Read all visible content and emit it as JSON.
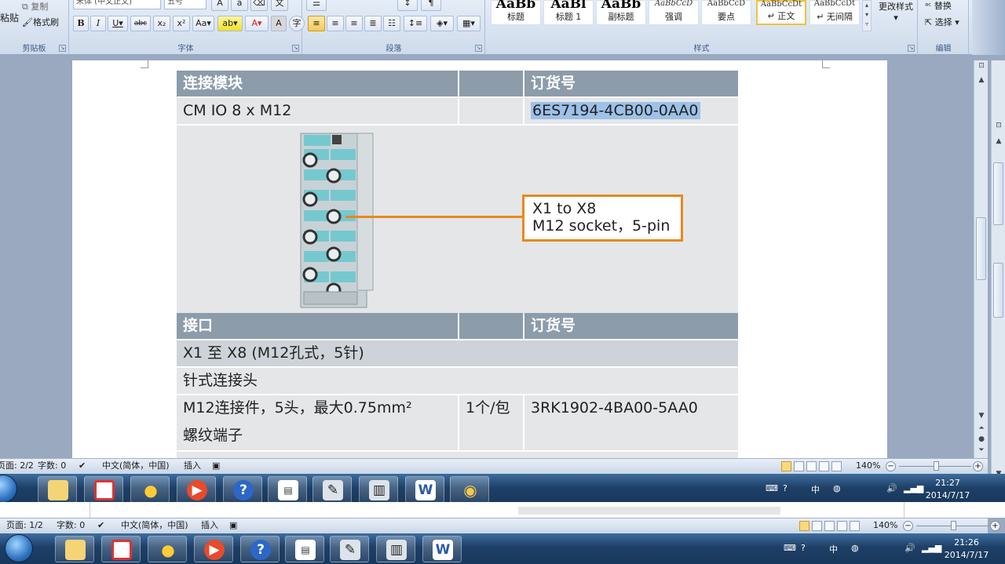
{
  "ribbon": {
    "clipboard": {
      "paste_label": "粘贴",
      "copy_label": "复制",
      "format_painter_label": "格式刷",
      "group_label": "剪贴板"
    },
    "font": {
      "font_name": "宋体 (中文正文)",
      "font_size": "五号",
      "group_label": "字体",
      "buttons": [
        "B",
        "I",
        "U",
        "abc",
        "x₂",
        "x²",
        "Aa",
        "ab",
        "A",
        "A",
        "字"
      ]
    },
    "paragraph": {
      "group_label": "段落"
    },
    "styles": {
      "group_label": "样式",
      "change_styles_label": "更改样式",
      "tiles": [
        {
          "preview": "AaBb",
          "name": "标题"
        },
        {
          "preview": "AaBl",
          "name": "标题 1"
        },
        {
          "preview": "AaBb",
          "name": "副标题"
        },
        {
          "preview": "AaBbCcD",
          "name": "强调"
        },
        {
          "preview": "AaBbCcD",
          "name": "要点"
        },
        {
          "preview": "AaBbCcDt",
          "name": "↵ 正文"
        },
        {
          "preview": "AaBbCcDt",
          "name": "↵ 无间隔"
        }
      ]
    },
    "editing": {
      "group_label": "编辑",
      "replace_label": "替换",
      "select_label": "选择"
    }
  },
  "document": {
    "table": {
      "header1": {
        "col1": "连接模块",
        "col2": "",
        "col3": "订货号"
      },
      "row1": {
        "col1": "CM IO 8 x M12",
        "col2": "",
        "col3": "6ES7194-4CB00-0AA0"
      },
      "callout": {
        "line1": "X1 to X8",
        "line2": "M12 socket，5-pin"
      },
      "header2": {
        "col1": "接口",
        "col2": "",
        "col3": "订货号"
      },
      "row2": {
        "col1": "X1 至 X8 (M12孔式，5针)"
      },
      "row3": {
        "col1": "针式连接头"
      },
      "row4": {
        "col1": "M12连接件，5头，最大0.75mm²",
        "col2": "1个/包",
        "col3": "3RK1902-4BA00-5AA0"
      },
      "row5": {
        "col1": "螺纹端子"
      }
    }
  },
  "status_top": {
    "page": "页面: 2/2",
    "words": "字数: 0",
    "language": "中文(简体，中国)",
    "mode": "插入",
    "zoom": "140%"
  },
  "status_bottom": {
    "page": "页面: 1/2",
    "words": "字数: 0",
    "language": "中文(简体，中国)",
    "mode": "插入",
    "zoom": "140%"
  },
  "taskbar_top": {
    "time": "21:27",
    "date": "2014/7/17"
  },
  "taskbar_bottom": {
    "time": "21:26",
    "date": "2014/7/17"
  },
  "taskbar_apps": [
    "file-explorer",
    "screen-capture",
    "qq-penguin",
    "media-player",
    "help",
    "notepad-doc",
    "tool-app",
    "monitor-app",
    "word",
    "paint"
  ],
  "colors": {
    "accent": "#e8891c",
    "table_header": "#8c9cab",
    "ribbon": "#dbe5f1"
  }
}
